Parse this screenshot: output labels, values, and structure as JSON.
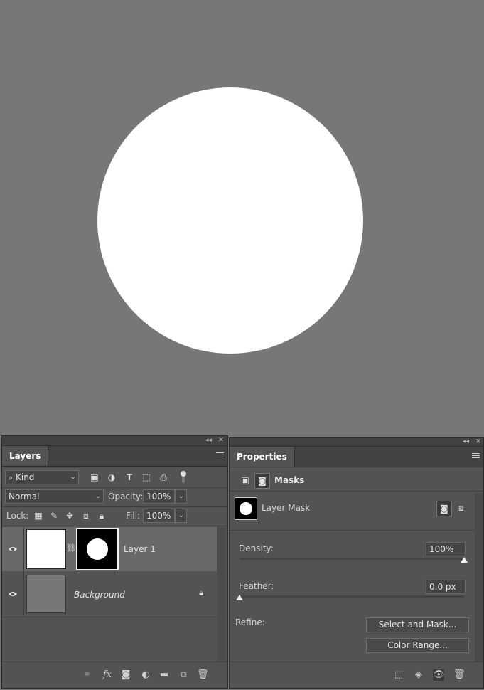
{
  "layers_panel": {
    "tab_label": "Layers",
    "filter": {
      "label": "Kind"
    },
    "blend_mode": "Normal",
    "opacity_label": "Opacity:",
    "opacity_value": "100%",
    "lock_label": "Lock:",
    "fill_label": "Fill:",
    "fill_value": "100%",
    "layers": [
      {
        "name": "Layer 1"
      },
      {
        "name": "Background"
      }
    ]
  },
  "properties_panel": {
    "tab_label": "Properties",
    "section_label": "Masks",
    "mask_name": "Layer Mask",
    "density_label": "Density:",
    "density_value": "100%",
    "density_level": 100,
    "feather_label": "Feather:",
    "feather_value": "0.0 px",
    "feather_level": 0,
    "refine_label": "Refine:",
    "select_and_mask_button": "Select and Mask...",
    "color_range_button": "Color Range..."
  },
  "colors": {
    "canvas": "#777777",
    "panel": "#535353",
    "shape": "#ffffff"
  },
  "icons": [
    "collapse-icon",
    "close-icon",
    "panel-menu-icon",
    "search-icon",
    "pixel-filter-icon",
    "adjustment-filter-icon",
    "type-filter-icon",
    "shape-filter-icon",
    "smart-object-filter-icon",
    "filter-toggle-icon",
    "lock-transparent-icon",
    "lock-paint-icon",
    "lock-position-icon",
    "lock-artboard-icon",
    "lock-all-icon",
    "eye-icon",
    "chain-link-icon",
    "lock-icon",
    "link-layers-icon",
    "fx-icon",
    "add-mask-icon",
    "adjustment-layer-icon",
    "group-folder-icon",
    "new-layer-icon",
    "trash-icon",
    "pixel-mask-icon",
    "vector-mask-icon",
    "load-selection-icon",
    "apply-mask-icon"
  ]
}
